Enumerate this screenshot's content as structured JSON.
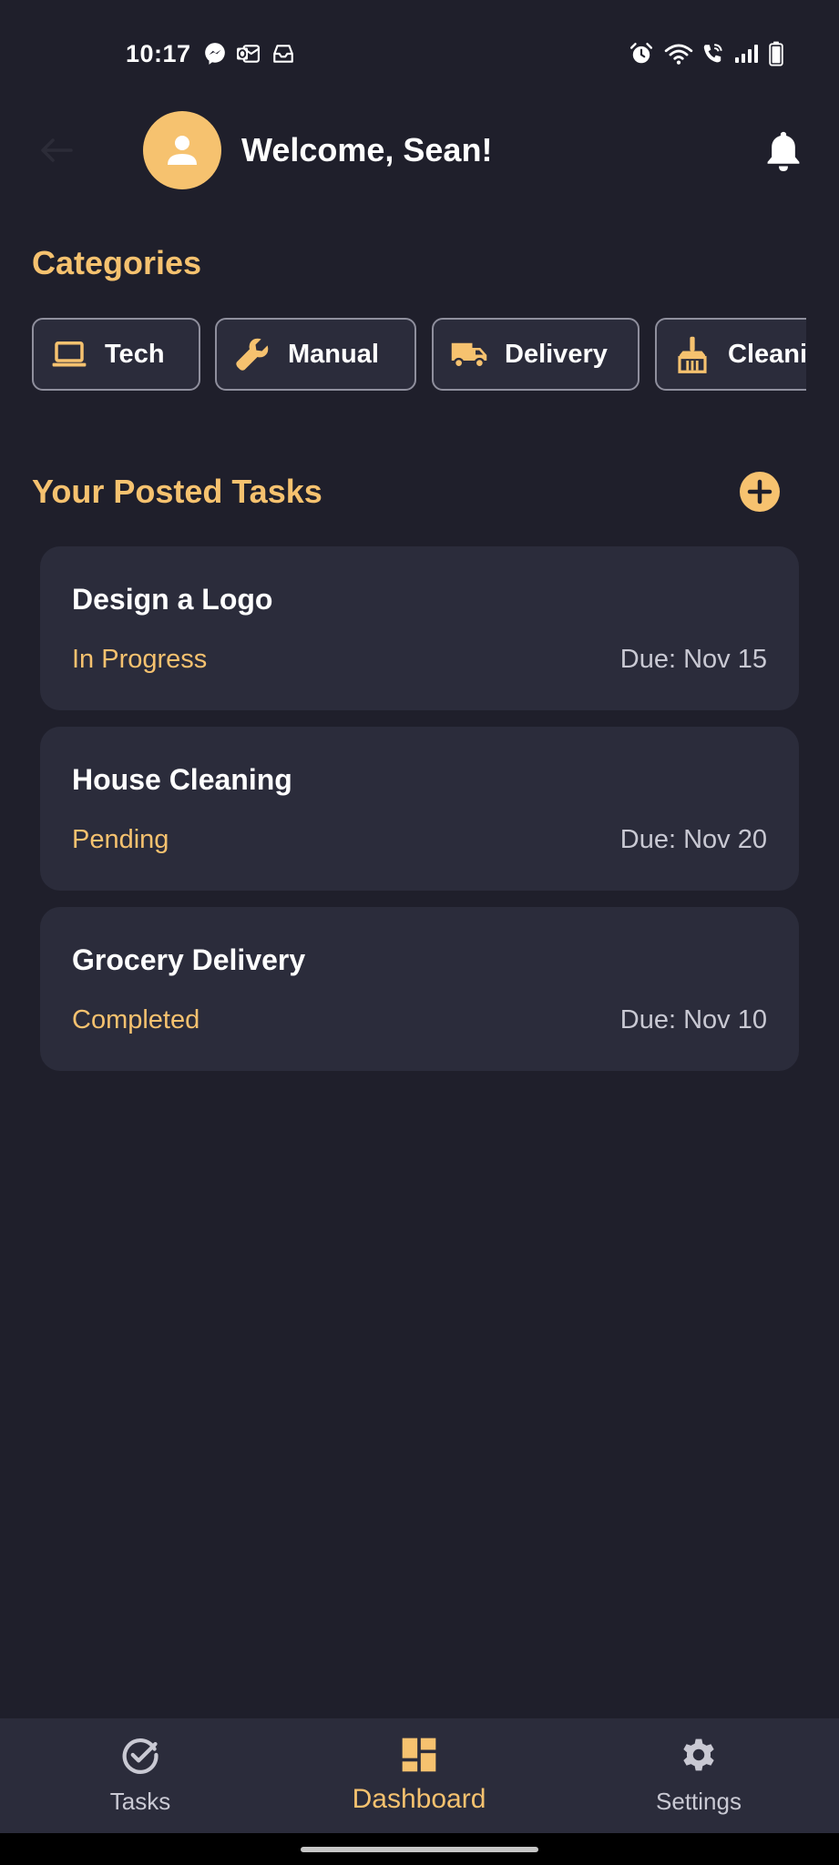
{
  "status_bar": {
    "time": "10:17",
    "left_icons": [
      "messenger-icon",
      "outlook-icon",
      "inbox-icon"
    ],
    "right_icons": [
      "alarm-icon",
      "wifi-icon",
      "wifi-calling-icon",
      "signal-icon",
      "battery-icon"
    ]
  },
  "header": {
    "welcome": "Welcome, Sean!",
    "avatar_icon": "person-icon",
    "notification_icon": "bell-icon"
  },
  "categories": {
    "title": "Categories",
    "items": [
      {
        "label": "Tech",
        "icon": "laptop-icon"
      },
      {
        "label": "Manual",
        "icon": "wrench-icon"
      },
      {
        "label": "Delivery",
        "icon": "truck-icon"
      },
      {
        "label": "Cleani",
        "icon": "broom-icon"
      }
    ]
  },
  "tasks": {
    "title": "Your Posted Tasks",
    "add_icon": "plus-circle-icon",
    "items": [
      {
        "title": "Design a Logo",
        "status": "In Progress",
        "due": "Due: Nov 15"
      },
      {
        "title": "House Cleaning",
        "status": "Pending",
        "due": "Due: Nov 20"
      },
      {
        "title": "Grocery Delivery",
        "status": "Completed",
        "due": "Due: Nov 10"
      }
    ]
  },
  "bottom_nav": {
    "items": [
      {
        "label": "Tasks",
        "icon": "check-circle-icon",
        "active": false
      },
      {
        "label": "Dashboard",
        "icon": "dashboard-icon",
        "active": true
      },
      {
        "label": "Settings",
        "icon": "gear-icon",
        "active": false
      }
    ]
  },
  "colors": {
    "background": "#1f1f2b",
    "card": "#2b2c3b",
    "accent": "#f6c26f",
    "text": "#ffffff",
    "muted": "#c9c9d3"
  }
}
